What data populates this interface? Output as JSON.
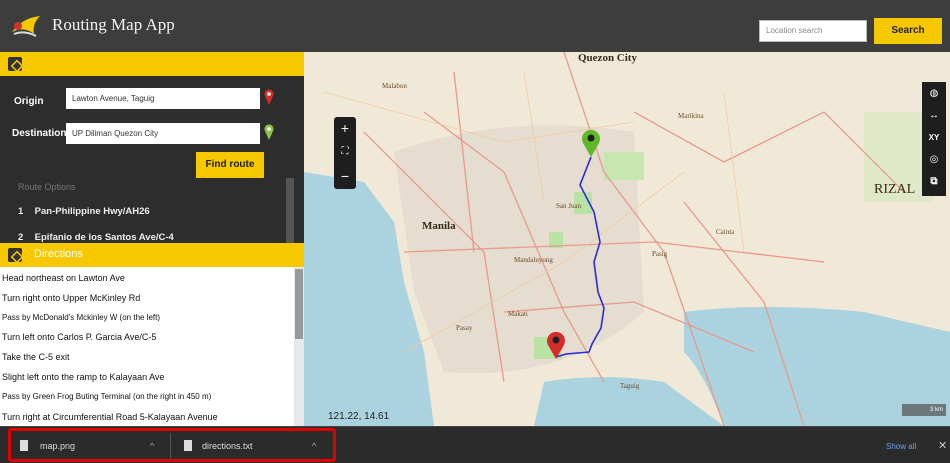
{
  "app": {
    "title": "Routing Map App"
  },
  "search": {
    "placeholder": "Location search",
    "button_label": "Search"
  },
  "routing": {
    "origin_label": "Origin",
    "origin_value": "Lawton Avenue, Taguig",
    "destination_label": "Destination",
    "destination_value": "UP Diliman Quezon City",
    "find_label": "Find route",
    "options_header": "Route Options",
    "options": [
      {
        "num": "1",
        "name": "Pan-Philippine Hwy/AH26"
      },
      {
        "num": "2",
        "name": "Epifanio de los Santos Ave/C-4"
      }
    ]
  },
  "directions": {
    "title": "Directions",
    "steps": [
      "Head northeast on Lawton Ave",
      "Turn right onto Upper McKinley Rd",
      "Pass by McDonald's Mckinley W (on the left)",
      "Turn left onto Carlos P. Garcia Ave/C-5",
      "Take the C-5 exit",
      "Slight left onto the ramp to Kalayaan Ave",
      "Pass by Green Frog Buting Terminal (on the right in 450 m)",
      "Turn right at Circumferential Road 5-Kalayaan Avenue"
    ]
  },
  "map": {
    "coords": "121.22, 14.61",
    "places": [
      "Quezon City",
      "Manila",
      "Marikina",
      "San Juan",
      "Mandaluyong",
      "Pasig",
      "Makati",
      "Pasay",
      "Taguig",
      "Cainta",
      "Malabon",
      "RIZAL"
    ],
    "scale_label": "3 km",
    "route_color": "#2b2bd8",
    "origin_marker_color": "#d42b2b",
    "dest_marker_color": "#5fb82a"
  },
  "downloads": {
    "items": [
      {
        "name": "map.png"
      },
      {
        "name": "directions.txt"
      }
    ],
    "show_all": "Show all"
  },
  "colors": {
    "accent": "#f6c800",
    "header": "#3d3d3d",
    "panel": "#2d2d2d",
    "highlight": "#e00000"
  }
}
